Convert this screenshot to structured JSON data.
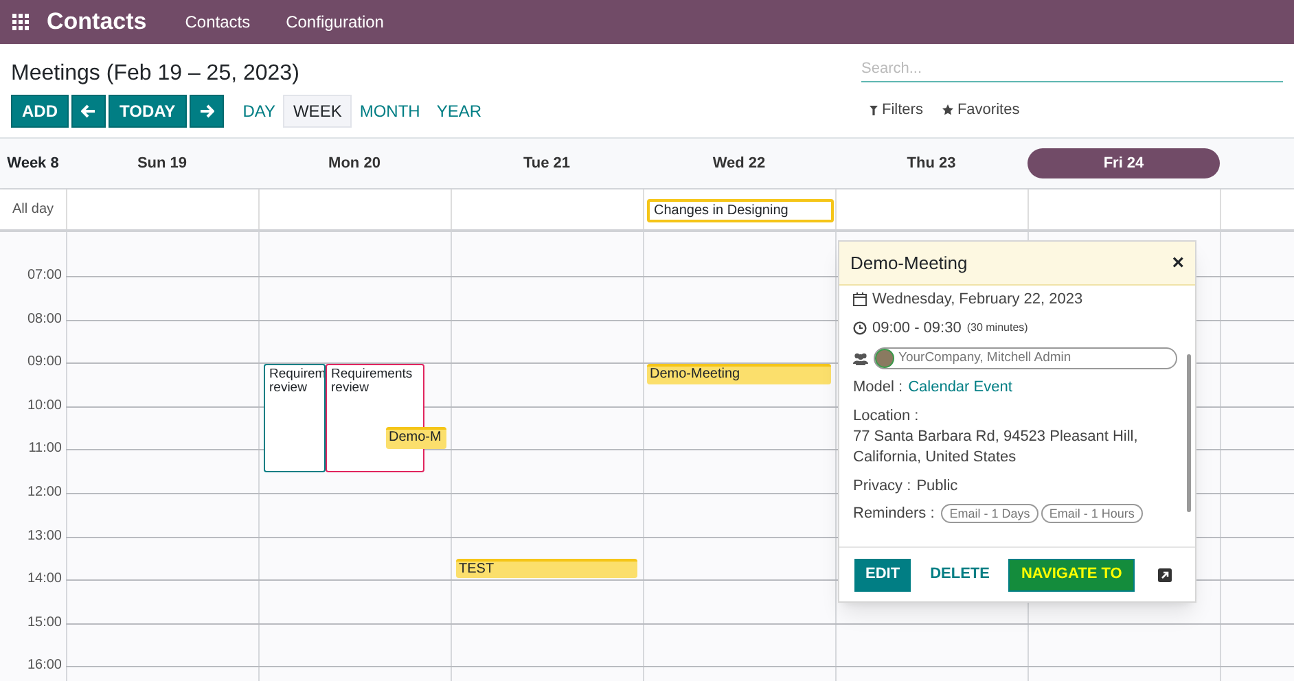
{
  "navbar": {
    "app_title": "Contacts",
    "menu": [
      "Contacts",
      "Configuration"
    ]
  },
  "control_panel": {
    "title": "Meetings (Feb 19 – 25, 2023)",
    "search": {
      "placeholder": "Search..."
    },
    "buttons": [
      "ADD",
      "TODAY"
    ],
    "views": [
      {
        "label": "DAY",
        "selected": false
      },
      {
        "label": "WEEK",
        "selected": true
      },
      {
        "label": "MONTH",
        "selected": false
      },
      {
        "label": "YEAR",
        "selected": false
      }
    ],
    "filters": [
      "Filters",
      "Favorites"
    ]
  },
  "calendar": {
    "week_label": "Week 8",
    "all_day_label": "All day",
    "days": [
      {
        "label": "Sun 19",
        "selected": false
      },
      {
        "label": "Mon 20",
        "selected": false
      },
      {
        "label": "Tue 21",
        "selected": false
      },
      {
        "label": "Wed 22",
        "selected": false
      },
      {
        "label": "Thu 23",
        "selected": false
      },
      {
        "label": "Fri 24",
        "selected": true
      }
    ],
    "hours": [
      "07:00",
      "08:00",
      "09:00",
      "10:00",
      "11:00",
      "12:00",
      "13:00",
      "14:00",
      "15:00",
      "16:00"
    ],
    "events": [
      {
        "title": "Changes in Designing",
        "kind": "allday",
        "color": "#f5c518"
      },
      {
        "title": "Requirem review",
        "kind": "outlined",
        "color": "#017e84"
      },
      {
        "title": "Requirements review",
        "kind": "outlined",
        "color": "#e0245e"
      },
      {
        "title": "Demo-M",
        "kind": "filled",
        "color": "#fbdf6c"
      },
      {
        "title": "TEST",
        "kind": "filled",
        "color": "#fbdf6c"
      },
      {
        "title": "Demo-Meeting",
        "kind": "filled",
        "color": "#fbdf6c"
      }
    ]
  },
  "popover": {
    "title": "Demo-Meeting",
    "close": "×",
    "date": "Wednesday, February 22, 2023",
    "time": "09:00 - 09:30",
    "duration": "(30 minutes)",
    "attendees": "YourCompany, Mitchell Admin",
    "fields": [
      {
        "label": "Model :",
        "value": "Calendar Event",
        "kind": "link"
      },
      {
        "label": "Location :",
        "value": "77 Santa Barbara Rd, 94523 Pleasant Hill, California, United States",
        "kind": "block"
      },
      {
        "label": "Privacy :",
        "value": "Public",
        "kind": "inline"
      }
    ],
    "reminders": {
      "label": "Reminders :",
      "tags": [
        "Email - 1 Days",
        "Email - 1 Hours"
      ]
    },
    "buttons": [
      "EDIT",
      "DELETE",
      "NAVIGATE TO"
    ]
  }
}
